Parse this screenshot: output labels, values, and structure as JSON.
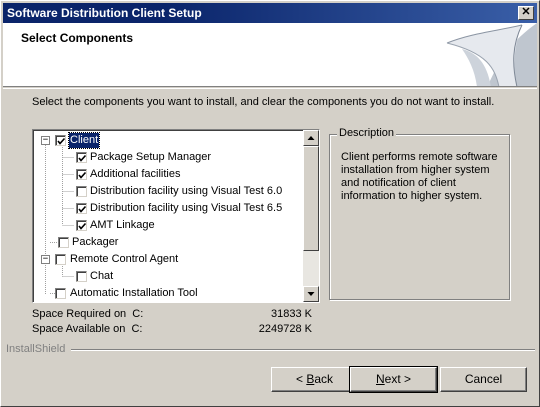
{
  "window": {
    "title": "Software Distribution Client Setup",
    "close_glyph": "✕"
  },
  "header": {
    "title": "Select Components"
  },
  "instructions": "Select the components you want to install, and clear the components you do not want to install.",
  "tree": {
    "items": [
      {
        "label": "Client",
        "checked": true,
        "expander": "minus",
        "selected": true
      },
      {
        "label": "Package Setup Manager",
        "checked": true
      },
      {
        "label": "Additional facilities",
        "checked": true
      },
      {
        "label": "Distribution facility using Visual Test 6.0",
        "checked": false
      },
      {
        "label": "Distribution facility using Visual Test 6.5",
        "checked": true
      },
      {
        "label": "AMT Linkage",
        "checked": true
      },
      {
        "label": "Packager",
        "checked": false
      },
      {
        "label": "Remote Control Agent",
        "checked": false,
        "expander": "minus"
      },
      {
        "label": "Chat",
        "checked": false
      },
      {
        "label": "Automatic Installation Tool",
        "checked": false
      }
    ]
  },
  "description": {
    "legend": "Description",
    "text": "Client performs remote software installation from higher system and notification of client information to higher system."
  },
  "space": {
    "required_label": "Space Required on  C:",
    "required_value": "31833 K",
    "available_label": "Space Available on  C:",
    "available_value": "2249728 K"
  },
  "branding": "InstallShield",
  "buttons": {
    "back_pre": "< ",
    "back_mnemonic": "B",
    "back_post": "ack",
    "next_mnemonic": "N",
    "next_post": "ext >",
    "cancel": "Cancel"
  },
  "colors": {
    "title_bar": "#0a246a",
    "dialog_bg": "#d4d0c8",
    "selection": "#0a246a"
  }
}
